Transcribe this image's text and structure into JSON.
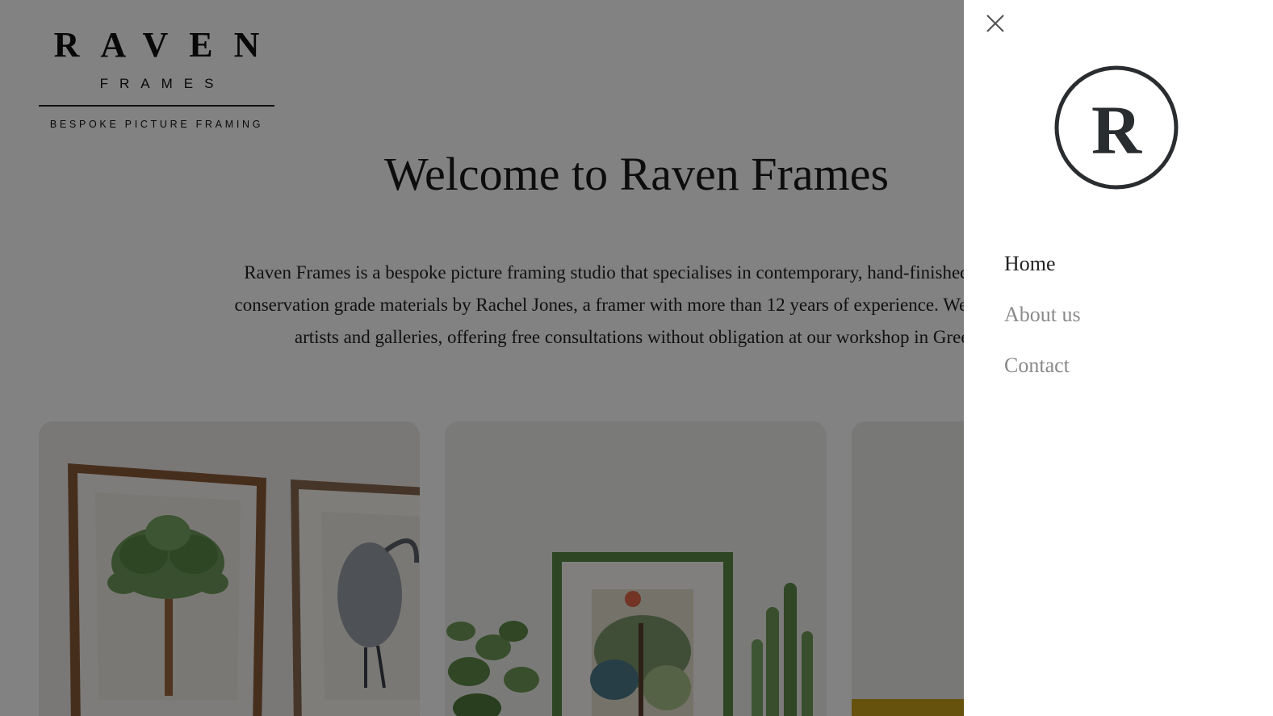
{
  "logo": {
    "main": "RAVEN",
    "sub": "FRAMES",
    "tagline": "BESPOKE PICTURE FRAMING"
  },
  "hero": {
    "title": "Welcome to Raven Frames",
    "lines": [
      "Raven Frames is a bespoke picture framing studio that specialises in contemporary, hand-finished frames.",
      "conservation grade materials by Rachel Jones, a framer with more than 12 years of experience. We work wit",
      "artists and galleries, offering free consultations without obligation at our workshop in Green"
    ]
  },
  "menu": {
    "logo_letter": "R",
    "items": [
      {
        "label": "Home",
        "active": true
      },
      {
        "label": "About us",
        "active": false
      },
      {
        "label": "Contact",
        "active": false
      }
    ]
  },
  "icons": {
    "close": "close-icon"
  },
  "colors": {
    "overlay": "#000000",
    "menu_background": "#ffffff",
    "active_text": "#222222",
    "inactive_text": "#8a8a8a",
    "frame_wood": "#8a5a3a",
    "frame_green": "#5b8a45"
  }
}
